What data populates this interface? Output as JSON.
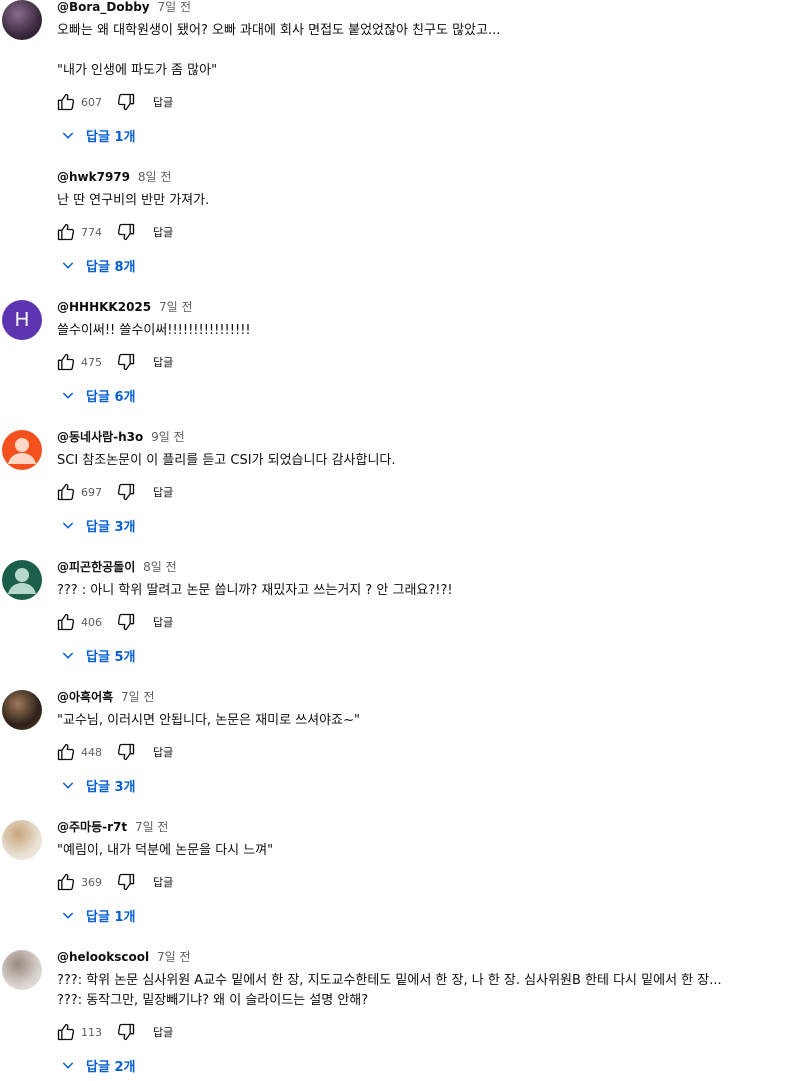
{
  "comments": [
    {
      "author": "@Bora_Dobby",
      "time": "7일 전",
      "text": "오빠는 왜 대학원생이 됐어? 오빠 과대에 회사 면접도 붙었었잖아 친구도 많았고...\n\n\"내가 인생에 파도가 좀 많아\"",
      "likes": "607",
      "reply_label": "답글",
      "replies_label": "답글 1개",
      "avatar": {
        "type": "photo",
        "colors": [
          "#3a2a3e",
          "#8a6a8e",
          "#1a0f1e"
        ]
      }
    },
    {
      "author": "@hwk7979",
      "time": "8일 전",
      "text": "난 딴 연구비의 반만 가져가.",
      "likes": "774",
      "reply_label": "답글",
      "replies_label": "답글 8개",
      "avatar": {
        "type": "none"
      }
    },
    {
      "author": "@HHHKK2025",
      "time": "7일 전",
      "text": "쓸수이써!! 쓸수이써!!!!!!!!!!!!!!!!",
      "likes": "475",
      "reply_label": "답글",
      "replies_label": "답글 6개",
      "avatar": {
        "type": "letter",
        "letter": "H",
        "bg": "#5e35b1"
      }
    },
    {
      "author": "@동네사람-h3o",
      "time": "9일 전",
      "text": "SCI 참조논문이 이 플리를 듣고 CSI가 되었습니다 감사합니다.",
      "likes": "697",
      "reply_label": "답글",
      "replies_label": "답글 3개",
      "avatar": {
        "type": "default",
        "bg": "#f4511e",
        "fg": "#ffd7c4"
      }
    },
    {
      "author": "@피곤한공돌이",
      "time": "8일 전",
      "text": "??? : 아니 학위 딸려고 논문 씁니까? 재밌자고 쓰는거지 ? 안 그래요?!?!",
      "likes": "406",
      "reply_label": "답글",
      "replies_label": "답글 5개",
      "avatar": {
        "type": "default",
        "bg": "#1b5e4a",
        "fg": "#b9d8cc"
      }
    },
    {
      "author": "@아흑어흑",
      "time": "7일 전",
      "text": "\"교수님, 이러시면 안됩니다, 논문은 재미로 쓰셔야죠~\"",
      "likes": "448",
      "reply_label": "답글",
      "replies_label": "답글 3개",
      "avatar": {
        "type": "photo",
        "colors": [
          "#2b2018",
          "#a07a5a",
          "#5a3f2a"
        ]
      }
    },
    {
      "author": "@주마등-r7t",
      "time": "7일 전",
      "text": "\"예림이, 내가 덕분에 논문을 다시 느껴\"",
      "likes": "369",
      "reply_label": "답글",
      "replies_label": "답글 1개",
      "avatar": {
        "type": "photo",
        "colors": [
          "#e8e0d4",
          "#c9a57a",
          "#f4efe8"
        ]
      }
    },
    {
      "author": "@helookscool",
      "time": "7일 전",
      "text": "???: 학위 논문 심사위원 A교수 밑에서 한 장, 지도교수한테도 밑에서 한 장, 나 한 장. 심사위원B 한테 다시 밑에서 한 장...\n???: 동작그만, 밑장빼기냐? 왜 이 슬라이드는 설명 안해?",
      "likes": "113",
      "reply_label": "답글",
      "replies_label": "답글 2개",
      "avatar": {
        "type": "photo",
        "colors": [
          "#d8d2cc",
          "#9a8a80",
          "#efebe7"
        ]
      }
    }
  ],
  "icons": {
    "like": "thumb-up-icon",
    "dislike": "thumb-down-icon",
    "expand": "chevron-down-icon"
  },
  "colors": {
    "link": "#065fd4",
    "meta": "#606060",
    "text": "#0f0f0f"
  }
}
